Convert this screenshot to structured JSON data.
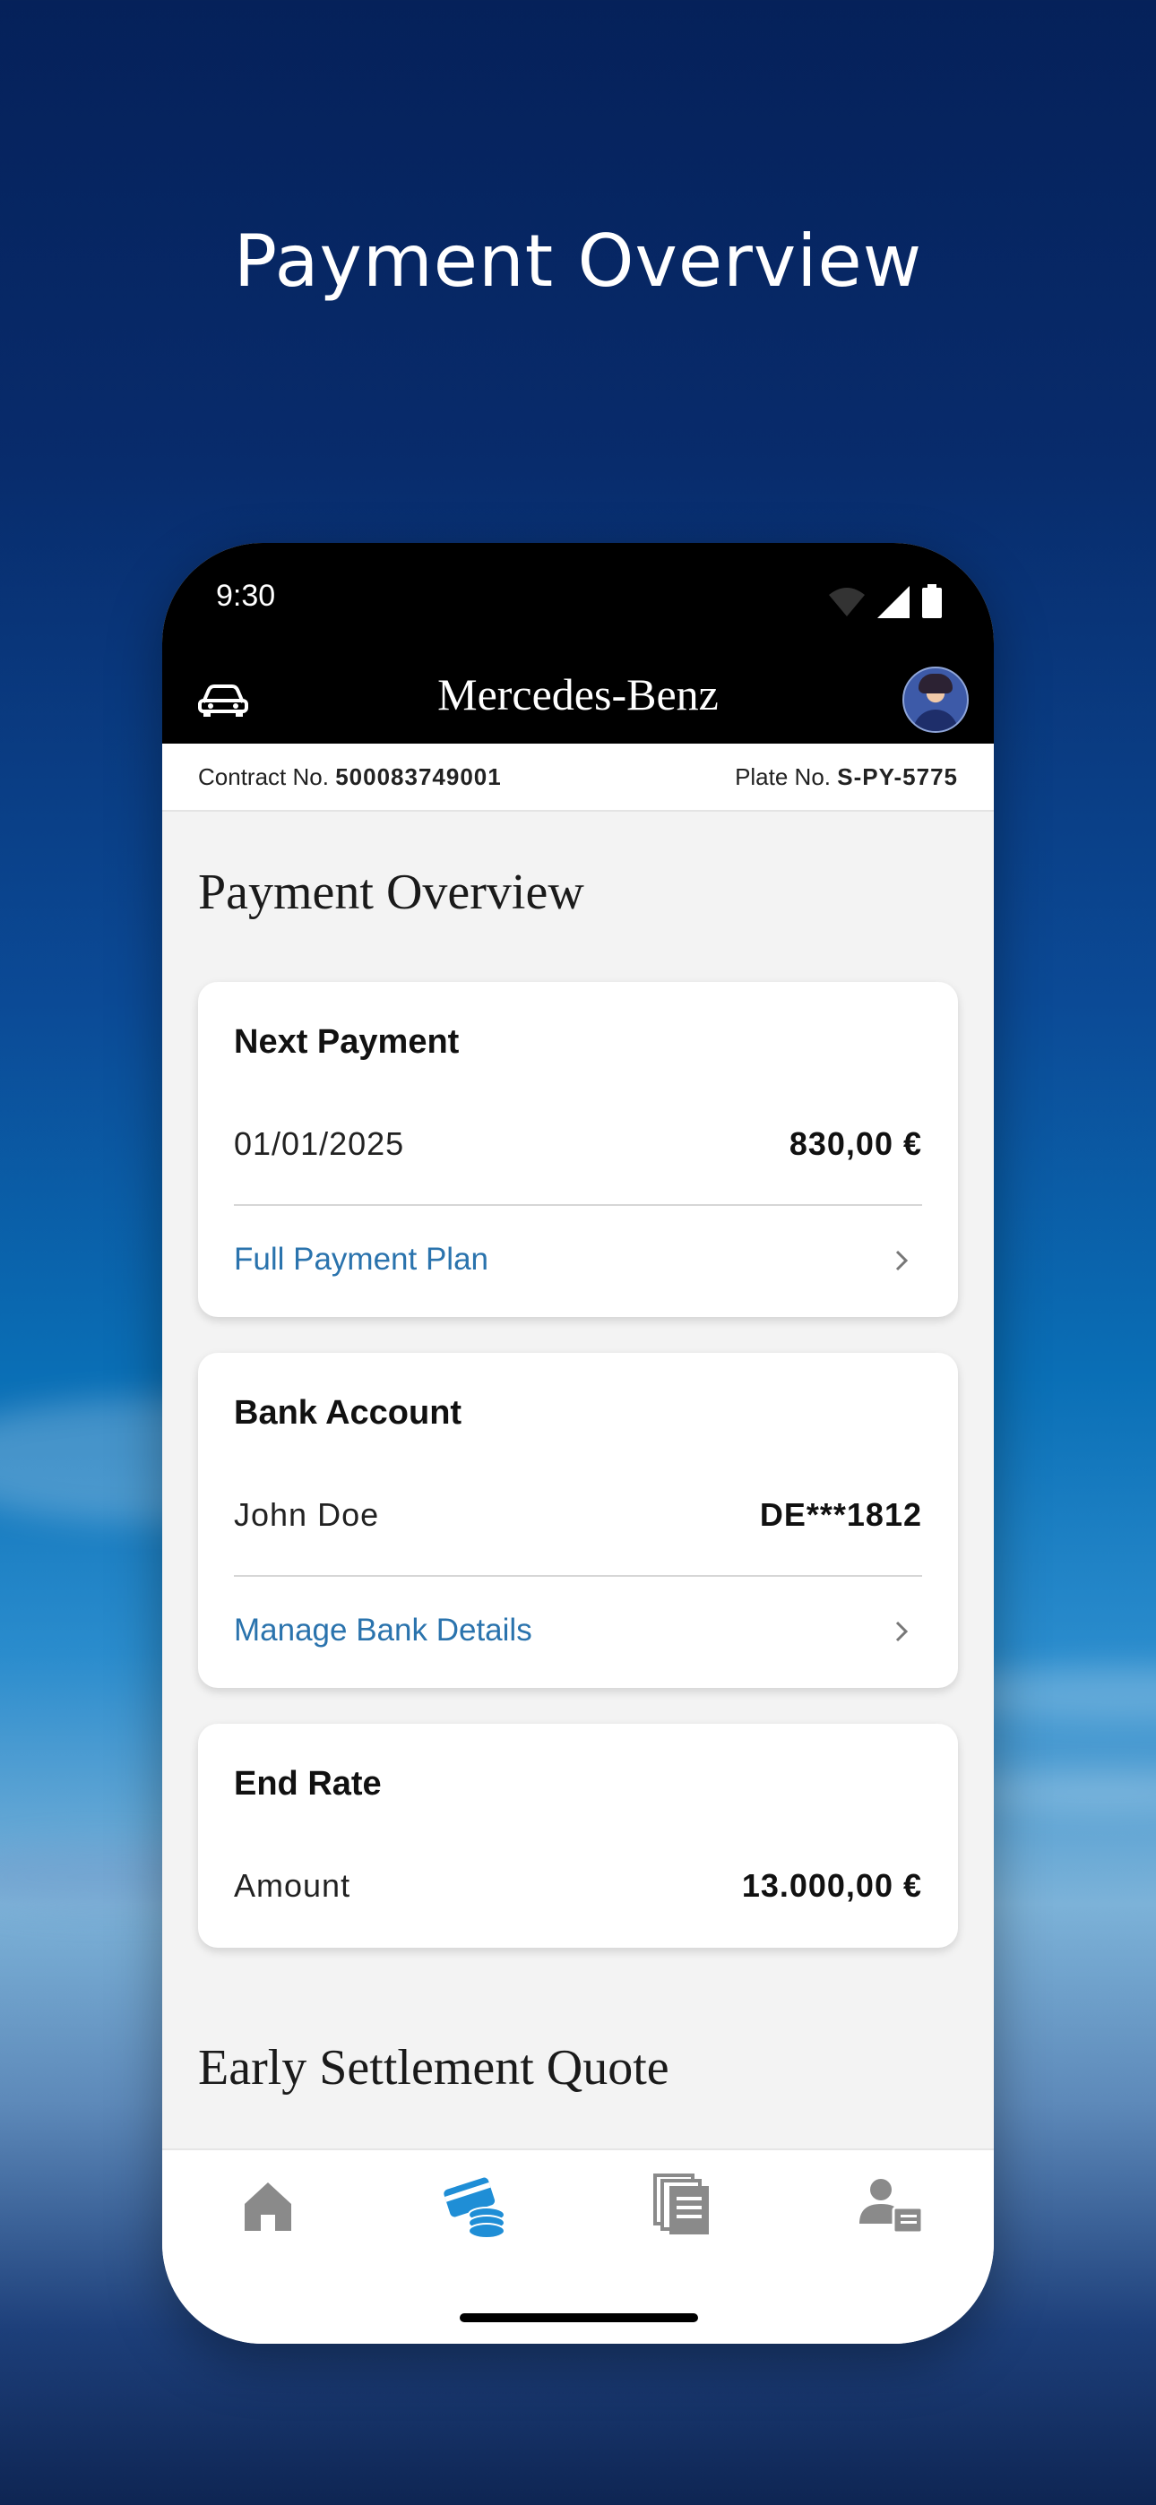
{
  "hero": {
    "title": "Payment Overview"
  },
  "status_bar": {
    "time": "9:30",
    "icons": [
      "wifi-icon",
      "signal-icon",
      "battery-icon"
    ]
  },
  "app_header": {
    "brand": "Mercedes-Benz",
    "left_icon": "car-icon",
    "right_icon": "avatar"
  },
  "contract": {
    "contract_label": "Contract No.",
    "contract_number": "500083749001",
    "plate_label": "Plate No.",
    "plate_number": "S-PY-5775"
  },
  "page_title": "Payment Overview",
  "cards": {
    "next_payment": {
      "title": "Next Payment",
      "date": "01/01/2025",
      "amount": "830,00 €",
      "link": "Full Payment Plan"
    },
    "bank_account": {
      "title": "Bank Account",
      "holder": "John Doe",
      "iban": "DE***1812",
      "link": "Manage Bank Details"
    },
    "end_rate": {
      "title": "End Rate",
      "label": "Amount",
      "amount": "13.000,00 €"
    }
  },
  "early_settlement_title": "Early Settlement Quote",
  "tabs": [
    {
      "name": "home",
      "icon": "home-icon",
      "active": false
    },
    {
      "name": "payments",
      "icon": "card-coins-icon",
      "active": true
    },
    {
      "name": "documents",
      "icon": "documents-icon",
      "active": false
    },
    {
      "name": "profile",
      "icon": "profile-icon",
      "active": false
    }
  ],
  "colors": {
    "accent": "#2a73ad",
    "active_tab": "#1f8ed6",
    "inactive_tab": "#8a8a8a"
  }
}
